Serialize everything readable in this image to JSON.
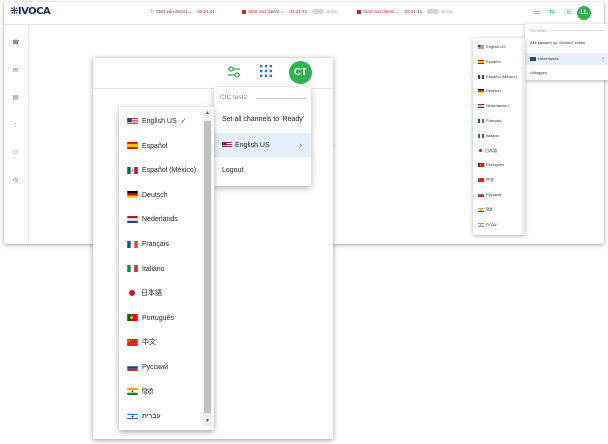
{
  "app": {
    "logo": "⁜IVOCA",
    "user_initials_small": "LL",
    "user_initials": "CT"
  },
  "status_bar": {
    "start_label": "Start van dienst",
    "timer": "02:21:41",
    "busy": "Bezig"
  },
  "small_menu": {
    "title": "CIC test2",
    "set_ready": "Alle kanalen op 'Gereed' zetten",
    "language": "Nederlands",
    "logout": "Uitloggen"
  },
  "small_languages": [
    "English US",
    "Español",
    "Español (México)",
    "Deutsch",
    "Nederlands ✓",
    "Français",
    "Italiano",
    "日本語",
    "Português",
    "中文",
    "Русский",
    "हिंदी",
    "עברית"
  ],
  "user_menu": {
    "title": "CIC test2",
    "set_ready": "Set all channels to 'Ready'",
    "language": "English US",
    "logout": "Logout"
  },
  "languages": [
    {
      "label": "English US",
      "check": "✓",
      "flag": "us"
    },
    {
      "label": "Español",
      "check": "",
      "flag": "es"
    },
    {
      "label": "Español (México)",
      "check": "",
      "flag": "mx"
    },
    {
      "label": "Deutsch",
      "check": "",
      "flag": "de"
    },
    {
      "label": "Nederlands",
      "check": "",
      "flag": "nl"
    },
    {
      "label": "Français",
      "check": "",
      "flag": "fr"
    },
    {
      "label": "Italiano",
      "check": "",
      "flag": "it"
    },
    {
      "label": "日本語",
      "check": "",
      "flag": "jp"
    },
    {
      "label": "Português",
      "check": "",
      "flag": "pt"
    },
    {
      "label": "中文",
      "check": "",
      "flag": "cn"
    },
    {
      "label": "Русский",
      "check": "",
      "flag": "ru"
    },
    {
      "label": "हिंदी",
      "check": "",
      "flag": "in"
    },
    {
      "label": "עברית",
      "check": "",
      "flag": "il"
    }
  ],
  "colors": {
    "accent": "#2fb350",
    "status_red": "#c4252f",
    "highlight": "#e5effa"
  }
}
